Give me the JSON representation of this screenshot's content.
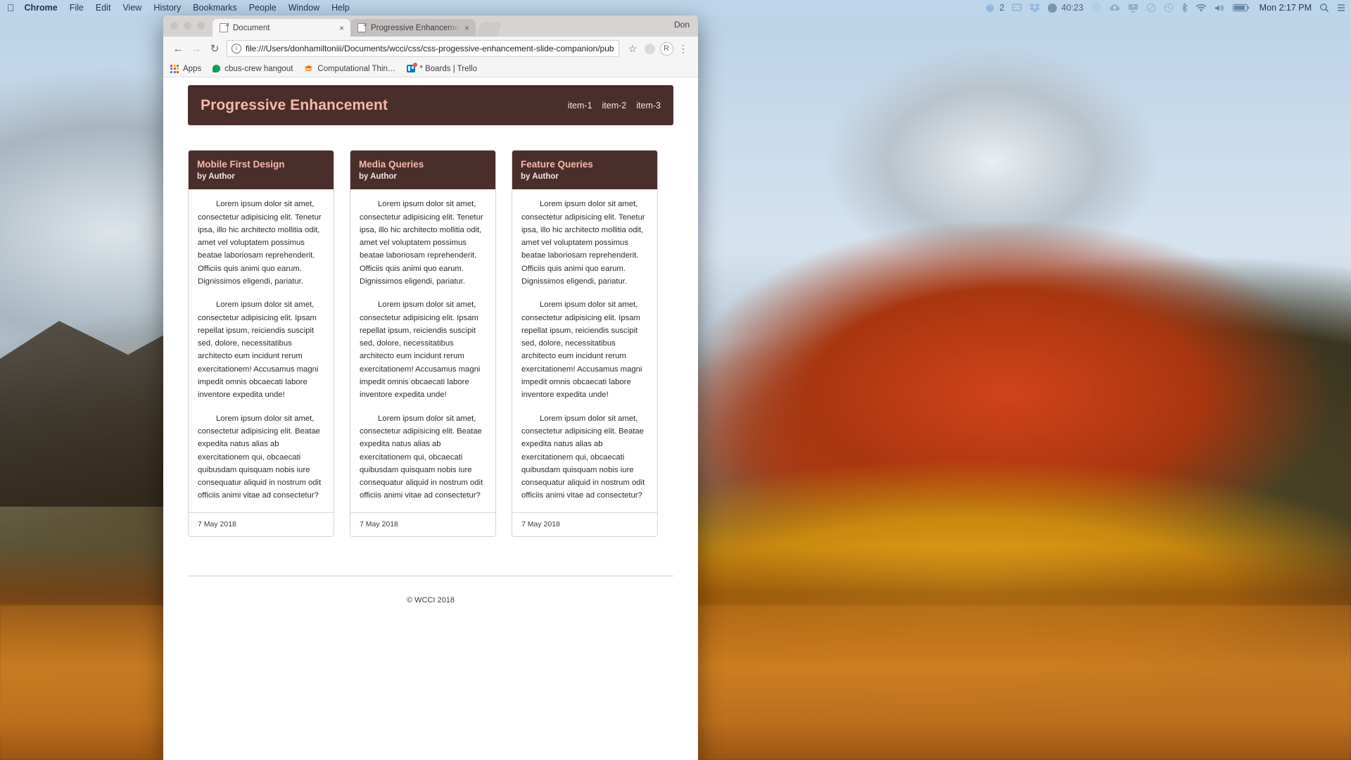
{
  "menubar": {
    "apple_icon": "apple-logo-icon",
    "items": [
      {
        "label": "Chrome",
        "bold": true
      },
      {
        "label": "File",
        "bold": false
      },
      {
        "label": "Edit",
        "bold": false
      },
      {
        "label": "View",
        "bold": false
      },
      {
        "label": "History",
        "bold": false
      },
      {
        "label": "Bookmarks",
        "bold": false
      },
      {
        "label": "People",
        "bold": false
      },
      {
        "label": "Window",
        "bold": false
      },
      {
        "label": "Help",
        "bold": false
      }
    ],
    "status": {
      "notification_count": "2",
      "timer": "40:23",
      "clock": "Mon 2:17 PM",
      "icons": [
        "tomato-timer-icon",
        "display-menu-icon",
        "dropbox-icon",
        "screen-recorder-icon",
        "airplay-icon",
        "cloud-upload-icon",
        "backup-icon",
        "do-not-disturb-icon",
        "time-machine-icon",
        "bluetooth-icon",
        "wifi-icon",
        "volume-icon",
        "battery-icon",
        "spotlight-search-icon",
        "notification-center-icon"
      ]
    }
  },
  "browser": {
    "window_user": "Don",
    "tabs": [
      {
        "title": "Document",
        "active": true,
        "close_label": "×",
        "favicon": "page-icon"
      },
      {
        "title": "Progressive Enhancement - O…",
        "active": false,
        "close_label": "×",
        "favicon": "page-icon"
      }
    ],
    "new_tab_label": "+",
    "toolbar": {
      "back_icon": "back-arrow-icon",
      "forward_icon": "forward-arrow-icon",
      "reload_icon": "reload-icon",
      "url": "file:///Users/donhamiltoniii/Documents/wcci/css/css-progessive-enhancement-slide-companion/public/i",
      "security_icon": "page-info-icon",
      "bookmark_star_icon": "star-icon",
      "extension_icon": "extension-circle-icon",
      "profile_label": "R",
      "menu_icon": "three-dot-menu-icon"
    },
    "bookmarks": [
      {
        "label": "Apps",
        "icon": "apps-grid-icon"
      },
      {
        "label": "cbus-crew hangout",
        "icon": "hangouts-icon"
      },
      {
        "label": "Computational Thin…",
        "icon": "mortarboard-icon"
      },
      {
        "label": "* Boards | Trello",
        "icon": "trello-icon"
      }
    ]
  },
  "page": {
    "header": {
      "title": "Progressive Enhancement",
      "nav": [
        {
          "label": "item-1"
        },
        {
          "label": "item-2"
        },
        {
          "label": "item-3"
        }
      ]
    },
    "cards": [
      {
        "title": "Mobile First Design",
        "author": "by Author",
        "paragraphs": [
          "Lorem ipsum dolor sit amet, consectetur adipisicing elit. Tenetur ipsa, illo hic architecto mollitia odit, amet vel voluptatem possimus beatae laboriosam reprehenderit. Officiis quis animi quo earum. Dignissimos eligendi, pariatur.",
          "Lorem ipsum dolor sit amet, consectetur adipisicing elit. Ipsam repellat ipsum, reiciendis suscipit sed, dolore, necessitatibus architecto eum incidunt rerum exercitationem! Accusamus magni impedit omnis obcaecati labore inventore expedita unde!",
          "Lorem ipsum dolor sit amet, consectetur adipisicing elit. Beatae expedita natus alias ab exercitationem qui, obcaecati quibusdam quisquam nobis iure consequatur aliquid in nostrum odit officiis animi vitae ad consectetur?"
        ],
        "date": "7 May 2018"
      },
      {
        "title": "Media Queries",
        "author": "by Author",
        "paragraphs": [
          "Lorem ipsum dolor sit amet, consectetur adipisicing elit. Tenetur ipsa, illo hic architecto mollitia odit, amet vel voluptatem possimus beatae laboriosam reprehenderit. Officiis quis animi quo earum. Dignissimos eligendi, pariatur.",
          "Lorem ipsum dolor sit amet, consectetur adipisicing elit. Ipsam repellat ipsum, reiciendis suscipit sed, dolore, necessitatibus architecto eum incidunt rerum exercitationem! Accusamus magni impedit omnis obcaecati labore inventore expedita unde!",
          "Lorem ipsum dolor sit amet, consectetur adipisicing elit. Beatae expedita natus alias ab exercitationem qui, obcaecati quibusdam quisquam nobis iure consequatur aliquid in nostrum odit officiis animi vitae ad consectetur?"
        ],
        "date": "7 May 2018"
      },
      {
        "title": "Feature Queries",
        "author": "by Author",
        "paragraphs": [
          "Lorem ipsum dolor sit amet, consectetur adipisicing elit. Tenetur ipsa, illo hic architecto mollitia odit, amet vel voluptatem possimus beatae laboriosam reprehenderit. Officiis quis animi quo earum. Dignissimos eligendi, pariatur.",
          "Lorem ipsum dolor sit amet, consectetur adipisicing elit. Ipsam repellat ipsum, reiciendis suscipit sed, dolore, necessitatibus architecto eum incidunt rerum exercitationem! Accusamus magni impedit omnis obcaecati labore inventore expedita unde!",
          "Lorem ipsum dolor sit amet, consectetur adipisicing elit. Beatae expedita natus alias ab exercitationem qui, obcaecati quibusdam quisquam nobis iure consequatur aliquid in nostrum odit officiis animi vitae ad consectetur?"
        ],
        "date": "7 May 2018"
      }
    ],
    "footer": "© WCCI 2018"
  },
  "colors": {
    "header_bg": "#4a2e2c",
    "header_title": "#f7b9a8",
    "page_bg": "#ffffff",
    "menubar_bg": "#bed6eb"
  }
}
